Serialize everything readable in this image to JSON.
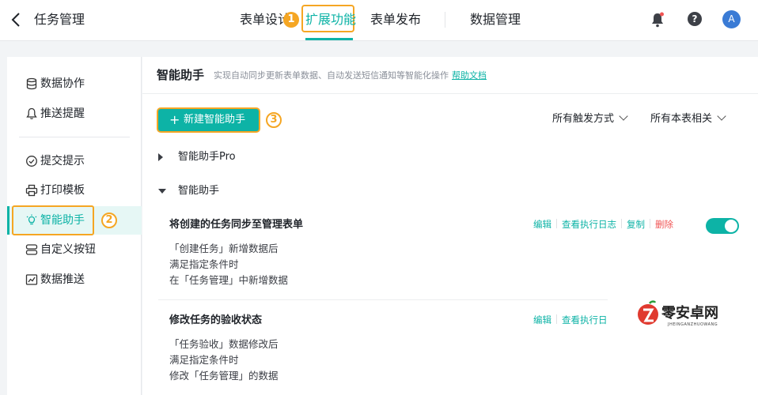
{
  "colors": {
    "accent": "#0db3a6",
    "annotation": "#f5a623",
    "danger": "#f05454",
    "avatar": "#3a7bd5"
  },
  "header": {
    "back_icon": "chevron-left-icon",
    "title": "任务管理",
    "tabs": [
      {
        "label": "表单设计",
        "active": false
      },
      {
        "label": "扩展功能",
        "active": true
      },
      {
        "label": "表单发布",
        "active": false
      },
      {
        "label": "数据管理",
        "active": false
      }
    ],
    "tab_annotation": "1",
    "help_label": "?",
    "avatar_label": "A"
  },
  "sidebar": {
    "items": [
      {
        "label": "数据协作",
        "icon": "database-icon"
      },
      {
        "label": "推送提醒",
        "icon": "bell-icon"
      },
      {
        "label": "提交提示",
        "icon": "check-circle-icon"
      },
      {
        "label": "打印模板",
        "icon": "printer-icon"
      },
      {
        "label": "智能助手",
        "icon": "bulb-icon",
        "active": true
      },
      {
        "label": "自定义按钮",
        "icon": "buttons-icon"
      },
      {
        "label": "数据推送",
        "icon": "chart-icon"
      }
    ],
    "active_annotation": "2"
  },
  "main": {
    "title": "智能助手",
    "description": "实现自动同步更新表单数据、自动发送短信通知等智能化操作",
    "help_link": "帮助文档",
    "new_button": "新建智能助手",
    "new_button_annotation": "3",
    "filters": [
      "所有触发方式",
      "所有本表相关"
    ],
    "groups": [
      {
        "label": "智能助手Pro",
        "expanded": false
      },
      {
        "label": "智能助手",
        "expanded": true
      }
    ],
    "cards": [
      {
        "title": "将创建的任务同步至管理表单",
        "lines": [
          "「创建任务」新增数据后",
          "满足指定条件时",
          "在「任务管理」中新增数据"
        ],
        "actions": [
          "编辑",
          "查看执行日志",
          "复制",
          "删除"
        ],
        "enabled": true
      },
      {
        "title": "修改任务的验收状态",
        "lines": [
          "「任务验收」数据修改后",
          "满足指定条件时",
          "修改「任务管理」的数据"
        ],
        "actions": [
          "编辑",
          "查看执行日"
        ]
      }
    ]
  },
  "watermark": {
    "text": "零安卓网",
    "subtext": "JHEINGANZHUOWANG"
  }
}
